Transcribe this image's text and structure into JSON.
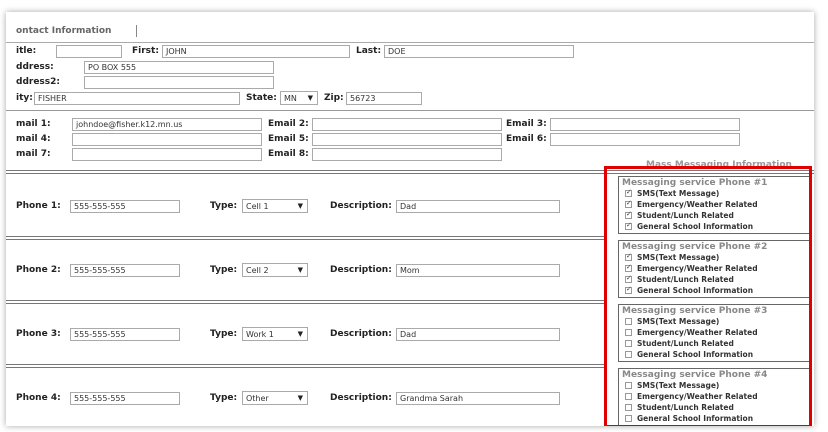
{
  "tab": {
    "label": "ontact Information"
  },
  "name": {
    "title_label": "itle:",
    "title_value": "",
    "first_label": "First:",
    "first_value": "JOHN",
    "last_label": "Last:",
    "last_value": "DOE"
  },
  "address": {
    "address_label": "ddress:",
    "address_value": "PO BOX 555",
    "address2_label": "ddress2:",
    "address2_value": "",
    "city_label": "ity:",
    "city_value": "FISHER",
    "state_label": "State:",
    "state_value": "MN",
    "zip_label": "Zip:",
    "zip_value": "56723"
  },
  "emails": {
    "email1_label": "mail 1:",
    "email1_value": "johndoe@fisher.k12.mn.us",
    "email2_label": "Email 2:",
    "email2_value": "",
    "email3_label": "Email 3:",
    "email3_value": "",
    "email4_label": "mail 4:",
    "email4_value": "",
    "email5_label": "Email 5:",
    "email5_value": "",
    "email6_label": "Email 6:",
    "email6_value": "",
    "email7_label": "mail 7:",
    "email7_value": "",
    "email8_label": "Email 8:",
    "email8_value": ""
  },
  "messaging_header": "Mass Messaging Information",
  "type_label": "Type:",
  "description_label": "Description:",
  "phones": [
    {
      "label": "Phone 1:",
      "value": "555-555-555",
      "type": "Cell 1",
      "description": "Dad",
      "msg_title": "Messaging service Phone #1",
      "checks": [
        {
          "label": "SMS(Text Message)",
          "checked": true
        },
        {
          "label": "Emergency/Weather Related",
          "checked": true
        },
        {
          "label": "Student/Lunch Related",
          "checked": true
        },
        {
          "label": "General School Information",
          "checked": true
        }
      ]
    },
    {
      "label": "Phone 2:",
      "value": "555-555-555",
      "type": "Cell 2",
      "description": "Mom",
      "msg_title": "Messaging service Phone #2",
      "checks": [
        {
          "label": "SMS(Text Message)",
          "checked": true
        },
        {
          "label": "Emergency/Weather Related",
          "checked": true
        },
        {
          "label": "Student/Lunch Related",
          "checked": true
        },
        {
          "label": "General School Information",
          "checked": true
        }
      ]
    },
    {
      "label": "Phone 3:",
      "value": "555-555-555",
      "type": "Work 1",
      "description": "Dad",
      "msg_title": "Messaging service Phone #3",
      "checks": [
        {
          "label": "SMS(Text Message)",
          "checked": false
        },
        {
          "label": "Emergency/Weather Related",
          "checked": false
        },
        {
          "label": "Student/Lunch Related",
          "checked": false
        },
        {
          "label": "General School Information",
          "checked": false
        }
      ]
    },
    {
      "label": "Phone 4:",
      "value": "555-555-555",
      "type": "Other",
      "description": "Grandma Sarah",
      "msg_title": "Messaging service Phone #4",
      "checks": [
        {
          "label": "SMS(Text Message)",
          "checked": false
        },
        {
          "label": "Emergency/Weather Related",
          "checked": false
        },
        {
          "label": "Student/Lunch Related",
          "checked": false
        },
        {
          "label": "General School Information",
          "checked": false
        }
      ]
    }
  ],
  "highlight_color": "#e00000"
}
